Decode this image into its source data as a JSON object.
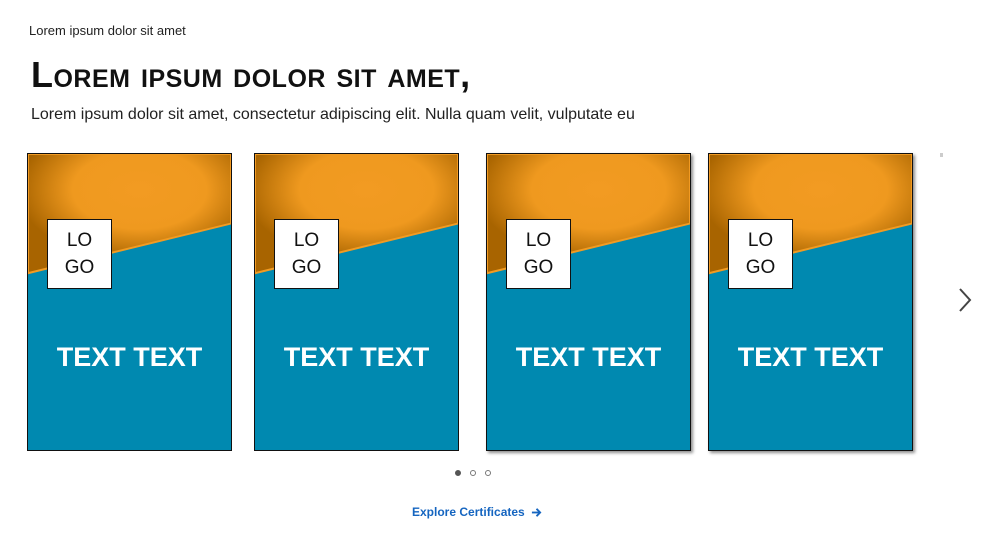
{
  "header": {
    "eyebrow": "Lorem ipsum dolor sit amet",
    "title": "Lorem ipsum dolor sit amet,",
    "subtitle": "Lorem ipsum dolor sit amet, consectetur adipiscing elit. Nulla quam velit, vulputate eu"
  },
  "carousel": {
    "cards": [
      {
        "logo_text": "LOGO",
        "text": "TEXT TEXT"
      },
      {
        "logo_text": "LOGO",
        "text": "TEXT TEXT"
      },
      {
        "logo_text": "LOGO",
        "text": "TEXT TEXT"
      },
      {
        "logo_text": "LOGO",
        "text": "TEXT TEXT"
      }
    ],
    "next_icon": "chevron-right-icon",
    "page_count": 3,
    "active_page": 1
  },
  "footer": {
    "explore_label": "Explore Certificates",
    "explore_icon": "arrow-right-icon"
  },
  "colors": {
    "card_blue": "#0089b0",
    "card_orange": "#f29b22",
    "card_orange_dark": "#a86400",
    "link_blue": "#1565c0"
  }
}
